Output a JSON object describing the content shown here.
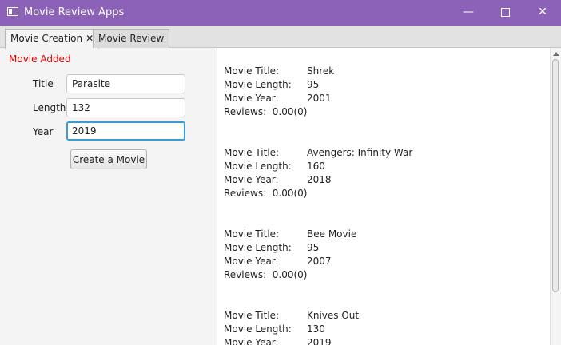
{
  "window": {
    "title": "Movie Review Apps",
    "minimize": "—",
    "close": "✕"
  },
  "tabs": [
    {
      "label": "Movie Creation",
      "close": "✕",
      "active": true
    },
    {
      "label": "Movie Review",
      "active": false
    }
  ],
  "form": {
    "status": "Movie Added",
    "title_label": "Title",
    "title_value": "Parasite",
    "length_label": "Length",
    "length_value": "132",
    "year_label": "Year",
    "year_value": "2019",
    "create_button": "Create a Movie"
  },
  "labels": {
    "movie_title": "Movie Title:",
    "movie_length": "Movie Length:",
    "movie_year": "Movie Year:",
    "reviews": "Reviews:"
  },
  "movies": [
    {
      "title": "Shrek",
      "length": "95",
      "year": "2001",
      "reviews": "0.00(0)"
    },
    {
      "title": "Avengers: Infinity War",
      "length": "160",
      "year": "2018",
      "reviews": "0.00(0)"
    },
    {
      "title": "Bee Movie",
      "length": "95",
      "year": "2007",
      "reviews": "0.00(0)"
    },
    {
      "title": "Knives Out",
      "length": "130",
      "year": "2019"
    }
  ],
  "colors": {
    "titlebar": "#8c62b8",
    "status": "#e00000",
    "focus": "#3c9ad6"
  }
}
